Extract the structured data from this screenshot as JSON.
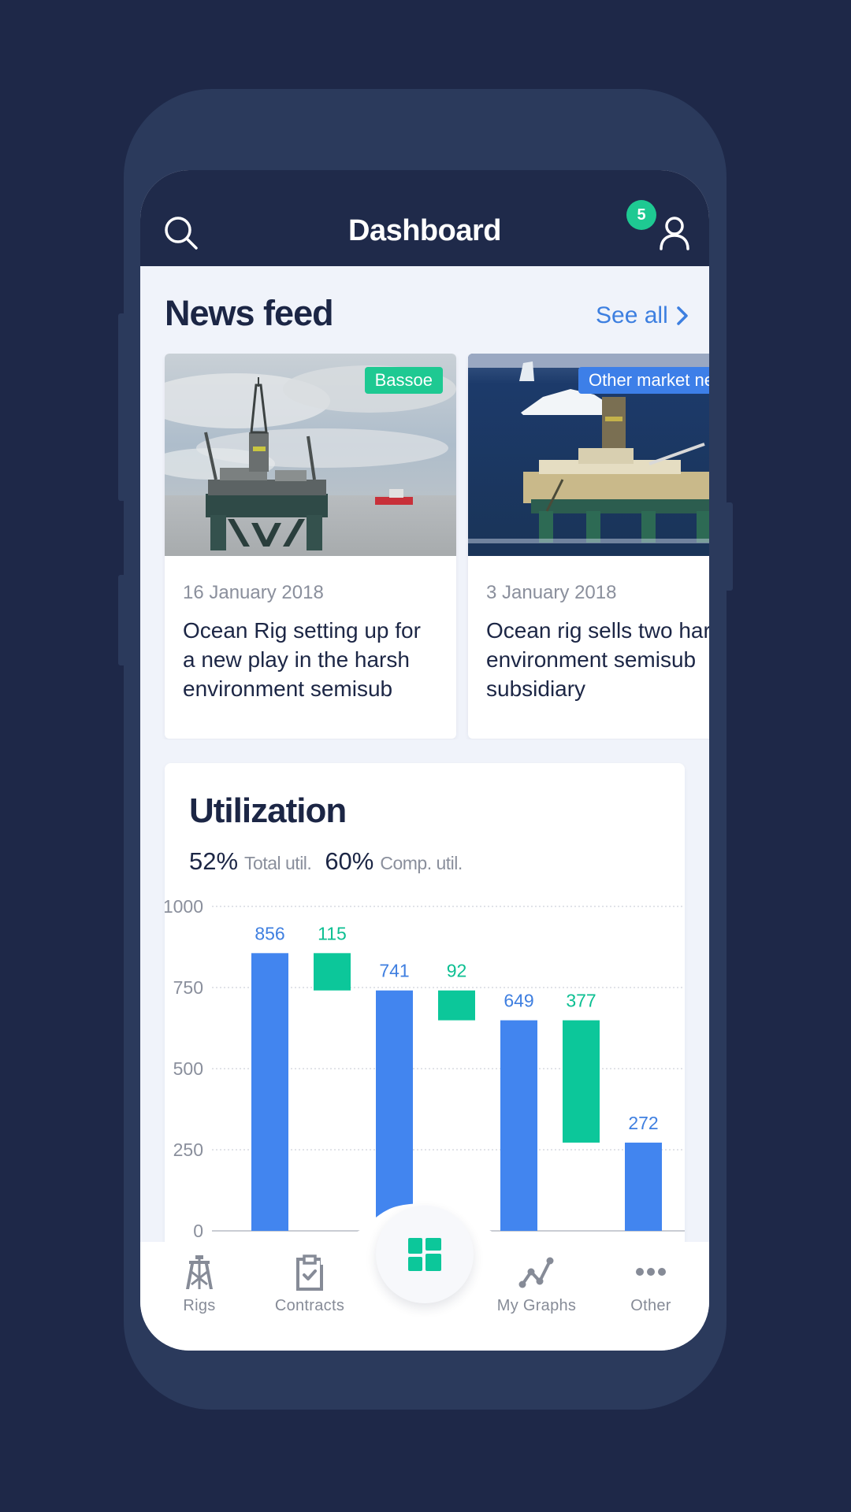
{
  "header": {
    "title": "Dashboard",
    "notification_count": "5",
    "search_icon": "search-icon",
    "user_icon": "user-icon"
  },
  "news": {
    "title": "News feed",
    "see_all": "See all",
    "items": [
      {
        "tag": "Bassoe",
        "tag_color": "#1ec992",
        "date": "16 January 2018",
        "headline_lines": [
          "Ocean Rig setting up for",
          "a new play in the harsh",
          "environment semisub"
        ]
      },
      {
        "tag": "Other market news",
        "tag_color": "#3d7fe8",
        "date": "3 January 2018",
        "headline_lines": [
          "Ocean rig sells two harsh",
          "environment semisub",
          "subsidiary"
        ]
      }
    ]
  },
  "utilization": {
    "title": "Utilization",
    "total_value": "52%",
    "total_label": "Total util.",
    "comp_value": "60%",
    "comp_label": "Comp. util."
  },
  "chart_data": {
    "type": "bar",
    "subtype": "waterfall",
    "ylim": [
      0,
      1000
    ],
    "yticks": [
      0,
      250,
      500,
      750,
      1000
    ],
    "ytick_labels": [
      "0",
      "250",
      "500",
      "750",
      "1000"
    ],
    "grid": true,
    "bars": [
      {
        "label": "856",
        "kind": "total",
        "bottom": 0,
        "top": 856,
        "color": "#4285ef"
      },
      {
        "label": "115",
        "kind": "delta",
        "bottom": 741,
        "top": 856,
        "color": "#0cc79a"
      },
      {
        "label": "741",
        "kind": "total",
        "bottom": 0,
        "top": 741,
        "color": "#4285ef"
      },
      {
        "label": "92",
        "kind": "delta",
        "bottom": 649,
        "top": 741,
        "color": "#0cc79a"
      },
      {
        "label": "649",
        "kind": "total",
        "bottom": 0,
        "top": 649,
        "color": "#4285ef"
      },
      {
        "label": "377",
        "kind": "delta",
        "bottom": 272,
        "top": 649,
        "color": "#0cc79a"
      },
      {
        "label": "272",
        "kind": "total",
        "bottom": 0,
        "top": 272,
        "color": "#4285ef"
      }
    ]
  },
  "nav": {
    "items": [
      {
        "label": "Rigs",
        "icon": "rig-icon"
      },
      {
        "label": "Contracts",
        "icon": "clipboard-check-icon"
      },
      {
        "label": "",
        "icon": "dashboard-icon",
        "active": true
      },
      {
        "label": "My Graphs",
        "icon": "line-graph-icon"
      },
      {
        "label": "Other",
        "icon": "more-icon"
      }
    ],
    "active_color": "#0cc79a",
    "inactive_color": "#868b97"
  }
}
